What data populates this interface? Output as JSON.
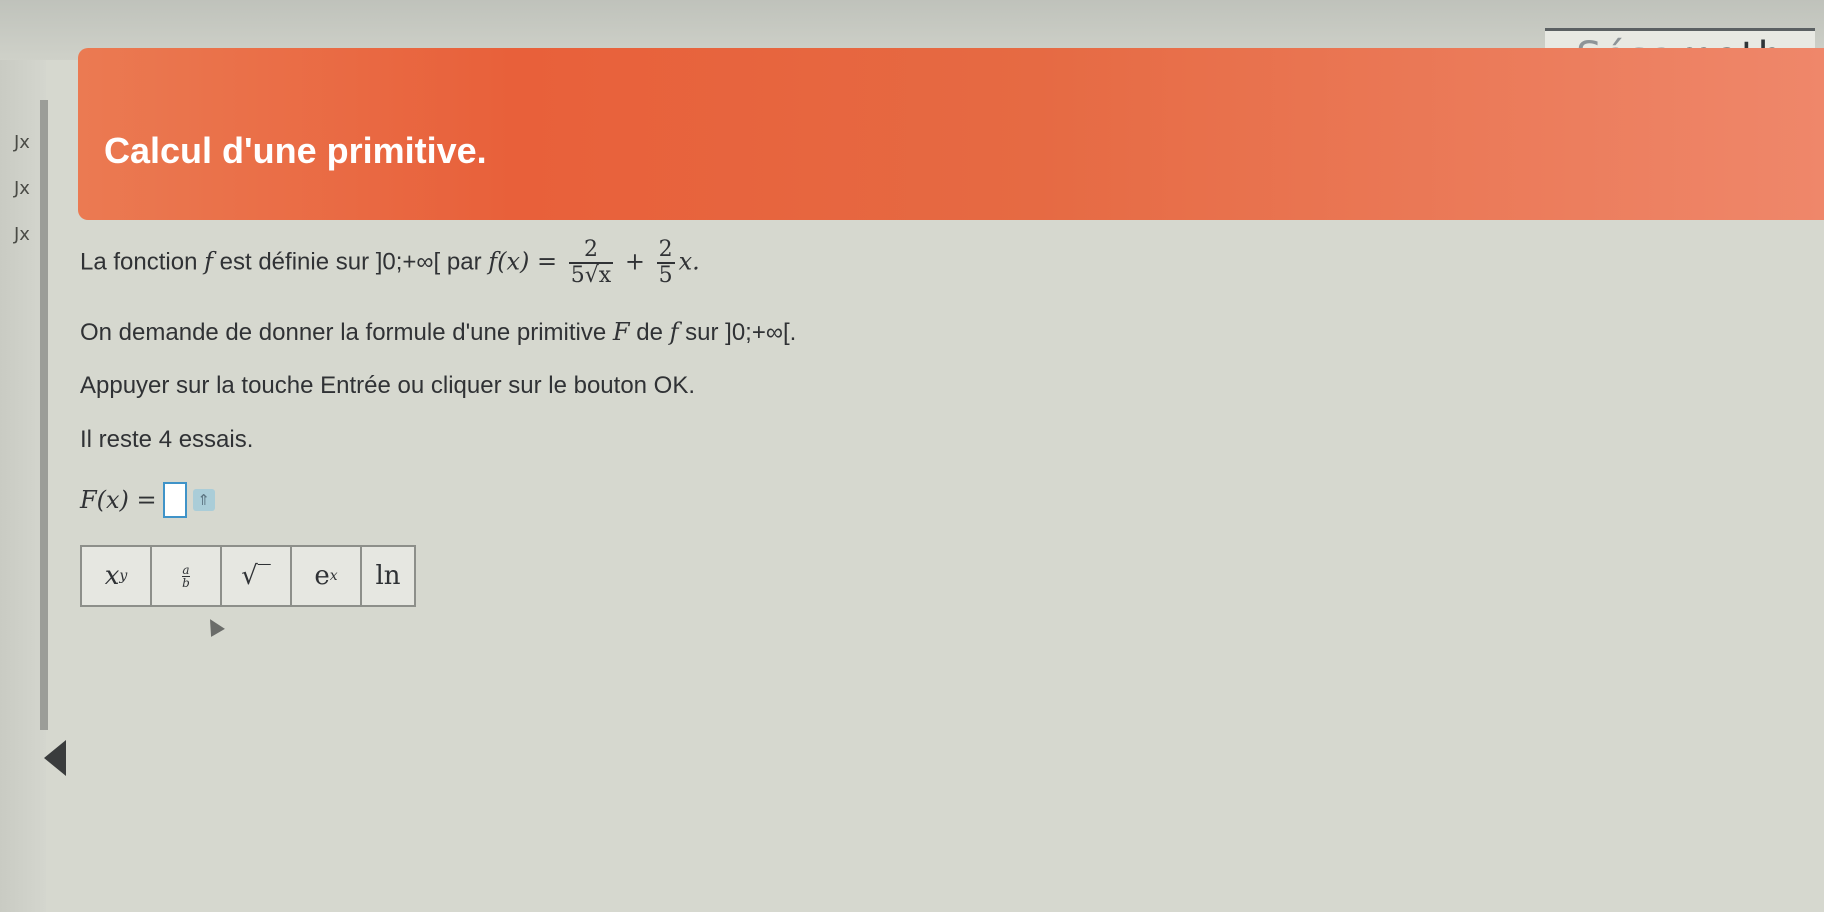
{
  "brand": {
    "part1": "Sésa",
    "part2": "math"
  },
  "header": {
    "title": "Calcul d'une primitive."
  },
  "sidebar": {
    "icon": "Jx"
  },
  "question": {
    "line1_prefix": "La fonction ",
    "line1_f": "f",
    "line1_mid": " est définie sur ",
    "interval": "]0;+∞[",
    "line1_par": " par ",
    "fx": "f(x) = ",
    "frac1_num": "2",
    "frac1_den": "5√x",
    "plus": " + ",
    "frac2_num": "2",
    "frac2_den": "5",
    "tail": "x.",
    "line2_a": "On demande de donner la formule d'une primitive ",
    "line2_F": "F",
    "line2_b": " de ",
    "line2_f": "f",
    "line2_c": " sur ",
    "line2_interval": "]0;+∞[.",
    "instruction": "Appuyer sur la touche Entrée ou cliquer sur le bouton OK.",
    "tries": "Il reste 4 essais."
  },
  "answer": {
    "label": "F(x) =",
    "arrow": "⇑"
  },
  "keypad": {
    "keys": [
      "x^y",
      "a/b",
      "√‾",
      "e^x",
      "ln"
    ],
    "power_base": "x",
    "power_exp": "y",
    "frac_a": "a",
    "frac_b": "b",
    "sqrt": "√‾",
    "exp_base": "e",
    "exp_exp": "x",
    "ln": "ln"
  },
  "colors": {
    "header": "#e8603a",
    "accent_box": "#3f93c8"
  }
}
